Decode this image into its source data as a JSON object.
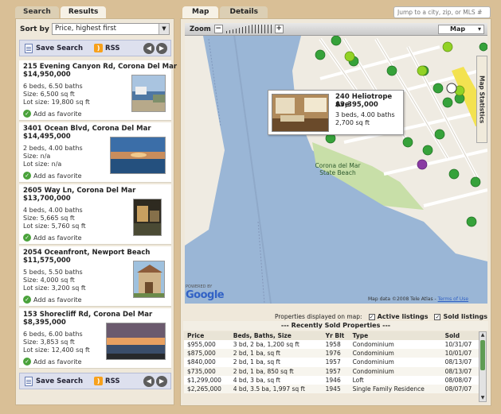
{
  "left_tabs": {
    "search": "Search",
    "results": "Results"
  },
  "sort": {
    "label": "Sort by",
    "value": "Price, highest first"
  },
  "save_bar": {
    "save_label": "Save Search",
    "rss_label": "RSS"
  },
  "listings": [
    {
      "address": "215 Evening Canyon Rd, Corona Del Mar",
      "price": "$14,950,000",
      "beds_baths": "6 beds, 6.50 baths",
      "size": "Size: 6,500 sq ft",
      "lot": "Lot size: 19,800 sq ft",
      "fav": "Add as favorite"
    },
    {
      "address": "3401 Ocean Blvd, Corona Del Mar",
      "price": "$14,495,000",
      "beds_baths": "2 beds, 4.00 baths",
      "size": "Size: n/a",
      "lot": "Lot size: n/a",
      "fav": "Add as favorite"
    },
    {
      "address": "2605 Way Ln, Corona Del Mar",
      "price": "$13,700,000",
      "beds_baths": "4 beds, 4.00 baths",
      "size": "Size: 5,665 sq ft",
      "lot": "Lot size: 5,760 sq ft",
      "fav": "Add as favorite"
    },
    {
      "address": "2054 Oceanfront, Newport Beach",
      "price": "$11,575,000",
      "beds_baths": "5 beds, 5.50 baths",
      "size": "Size: 4,000 sq ft",
      "lot": "Lot size: 3,200 sq ft",
      "fav": "Add as favorite"
    },
    {
      "address": "153 Shorecliff Rd, Corona Del Mar",
      "price": "$8,395,000",
      "beds_baths": "6 beds, 6.00 baths",
      "size": "Size: 3,853 sq ft",
      "lot": "Lot size: 12,400 sq ft",
      "fav": "Add as favorite"
    }
  ],
  "right_tabs": {
    "map": "Map",
    "details": "Details"
  },
  "jump": {
    "placeholder": "Jump to a city, zip, or MLS #"
  },
  "map": {
    "zoom_label": "Zoom",
    "zoom_minus": "−",
    "zoom_plus": "+",
    "map_type": "Map",
    "statistics_tab": "Map Statistics",
    "beach_label": "Corona del Mar State Beach",
    "google": "Google",
    "powered_by": "POWERED BY",
    "map_data": "Map data ©2008 Tele Atlas -",
    "terms": "Terms of Use",
    "popup": {
      "address": "240 Heliotrope Ave",
      "price": "$3,395,000",
      "beds": "3 beds, 4.00 baths",
      "size": "2,700 sq ft"
    }
  },
  "legend": {
    "label": "Properties displayed on map:",
    "active": "Active listings",
    "sold": "Sold listings"
  },
  "sold_title": "--- Recently Sold Properties ---",
  "sold_table": {
    "headers": [
      "Price",
      "Beds, Baths, Size",
      "Yr Blt",
      "Type",
      "Sold"
    ],
    "rows": [
      [
        "$955,000",
        "3 bd, 2 ba, 1,200 sq ft",
        "1958",
        "Condominium",
        "10/31/07"
      ],
      [
        "$875,000",
        "2 bd, 1 ba, sq ft",
        "1976",
        "Condominium",
        "10/01/07"
      ],
      [
        "$840,000",
        "2 bd, 1 ba, sq ft",
        "1957",
        "Condominium",
        "08/13/07"
      ],
      [
        "$735,000",
        "2 bd, 1 ba, 850 sq ft",
        "1957",
        "Condominium",
        "08/13/07"
      ],
      [
        "$1,299,000",
        "4 bd, 3 ba, sq ft",
        "1946",
        "Loft",
        "08/08/07"
      ],
      [
        "$2,265,000",
        "4 bd, 3.5 ba, 1,997 sq ft",
        "1945",
        "Single Family Residence",
        "08/07/07"
      ]
    ]
  },
  "colors": {
    "bg": "#d9bf96",
    "water": "#9ab6d6",
    "land": "#efebe2",
    "park": "#c8dfa8",
    "marker": "#36a23a",
    "accent_link": "#3262c5"
  }
}
